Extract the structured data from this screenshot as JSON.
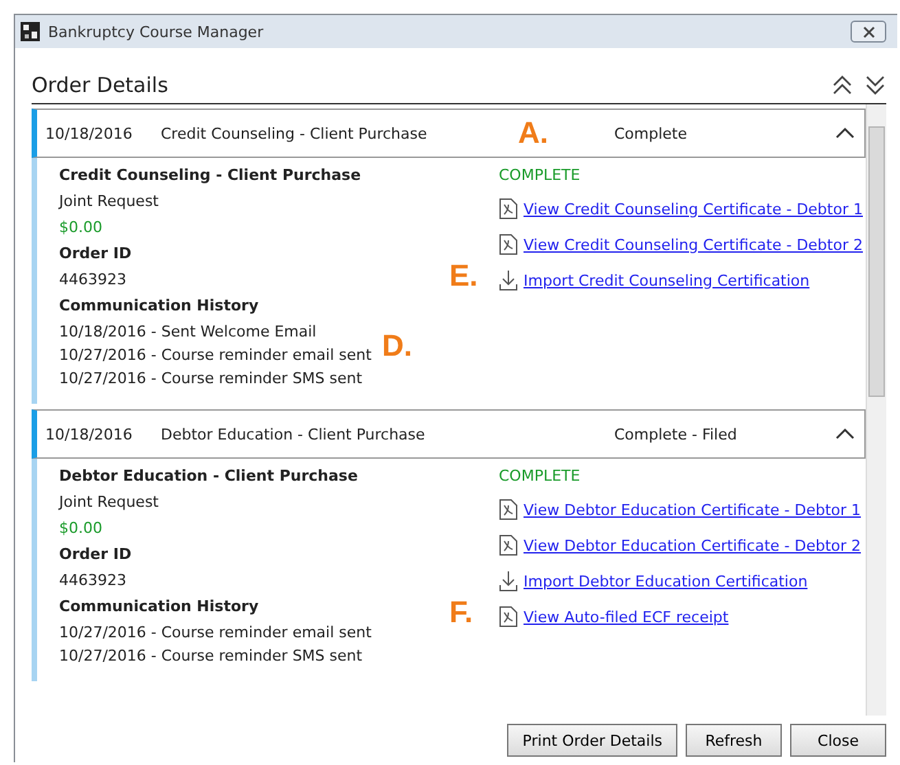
{
  "window": {
    "title": "Bankruptcy Course Manager"
  },
  "heading": "Order Details",
  "orders": [
    {
      "date": "10/18/2016",
      "title": "Credit Counseling - Client Purchase",
      "status": "Complete",
      "expanded": true,
      "callout": "A.",
      "name": "Credit Counseling - Client Purchase",
      "request": "Joint Request",
      "price": "$0.00",
      "order_id_label": "Order ID",
      "order_id": "4463923",
      "history_label": "Communication History",
      "history": [
        "10/18/2016 - Sent Welcome Email",
        "10/27/2016 - Course reminder email sent",
        "10/27/2016 - Course reminder SMS sent"
      ],
      "history_callout": "D.",
      "state": "COMPLETE",
      "links": [
        {
          "kind": "pdf",
          "label": "View Credit Counseling Certificate - Debtor 1"
        },
        {
          "kind": "pdf",
          "label": "View Credit Counseling Certificate - Debtor 2"
        },
        {
          "kind": "import",
          "label": "Import Credit Counseling Certification",
          "callout": "E."
        }
      ]
    },
    {
      "date": "10/18/2016",
      "title": "Debtor Education - Client Purchase",
      "status": "Complete - Filed",
      "expanded": true,
      "name": "Debtor Education - Client Purchase",
      "request": "Joint Request",
      "price": "$0.00",
      "order_id_label": "Order ID",
      "order_id": "4463923",
      "history_label": "Communication History",
      "history": [
        "10/27/2016 - Course reminder email sent",
        "10/27/2016 - Course reminder SMS sent"
      ],
      "state": "COMPLETE",
      "links": [
        {
          "kind": "pdf",
          "label": "View Debtor Education Certificate - Debtor 1"
        },
        {
          "kind": "pdf",
          "label": "View Debtor Education Certificate - Debtor 2"
        },
        {
          "kind": "import",
          "label": "Import Debtor Education Certification"
        },
        {
          "kind": "pdf",
          "label": "View Auto-filed ECF receipt",
          "callout": "F."
        }
      ]
    }
  ],
  "buttons": [
    "Print Order Details",
    "Refresh",
    "Close"
  ]
}
